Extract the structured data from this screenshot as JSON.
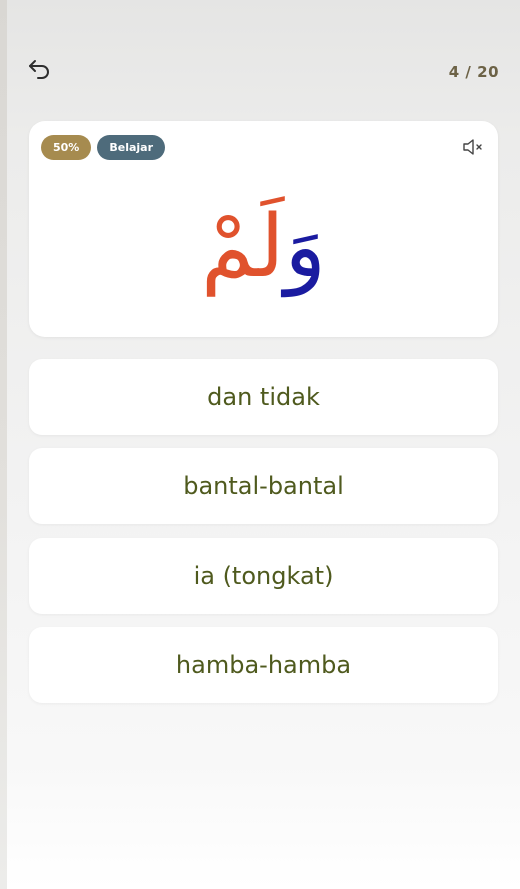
{
  "header": {
    "back_icon": "undo-arrow-icon",
    "progress": "4 / 20"
  },
  "card": {
    "badge_percent": "50%",
    "badge_mode": "Belajar",
    "mute_icon": "speaker-muted-icon",
    "word_part_1": "وَ",
    "word_part_2": "لَمْ",
    "colors": {
      "part_1": "#1a1ba0",
      "part_2": "#e0522d"
    }
  },
  "options": [
    {
      "label": "dan tidak"
    },
    {
      "label": "bantal-bantal"
    },
    {
      "label": "ia (tongkat)"
    },
    {
      "label": "hamba-hamba"
    }
  ]
}
